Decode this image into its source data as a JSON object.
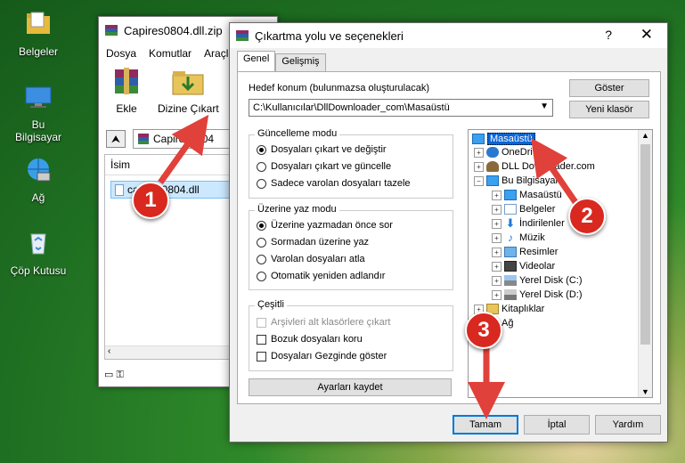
{
  "desktop": {
    "icons": [
      {
        "label": "Belgeler",
        "icon": "documents-folder-icon"
      },
      {
        "label": "Bu Bilgisayar",
        "icon": "computer-icon"
      },
      {
        "label": "Ağ",
        "icon": "network-icon"
      },
      {
        "label": "Çöp Kutusu",
        "icon": "recycle-bin-icon"
      }
    ]
  },
  "winrar": {
    "title": "Capires0804.dll.zip",
    "menu": [
      "Dosya",
      "Komutlar",
      "Araçla"
    ],
    "toolbar": {
      "add": "Ekle",
      "extract_to": "Dizine Çıkart"
    },
    "path": "Capires0804",
    "column_name": "İsim",
    "file": "capires0804.dll"
  },
  "dialog": {
    "title": "Çıkartma yolu ve seçenekleri",
    "help": "?",
    "close": "✕",
    "tabs": [
      "Genel",
      "Gelişmiş"
    ],
    "dest_label": "Hedef konum (bulunmazsa oluşturulacak)",
    "dest_value": "C:\\Kullanıcılar\\DllDownloader_com\\Masaüstü",
    "show_btn": "Göster",
    "new_folder_btn": "Yeni klasör",
    "update_mode": {
      "title": "Güncelleme modu",
      "options": [
        "Dosyaları çıkart ve değiştir",
        "Dosyaları çıkart ve güncelle",
        "Sadece varolan dosyaları tazele"
      ],
      "selected": 0
    },
    "overwrite_mode": {
      "title": "Üzerine yaz modu",
      "options": [
        "Üzerine yazmadan önce sor",
        "Sormadan üzerine yaz",
        "Varolan dosyaları atla",
        "Otomatik yeniden adlandır"
      ],
      "selected": 0
    },
    "misc": {
      "title": "Çeşitli",
      "options": [
        "Arşivleri alt klasörlere çıkart",
        "Bozuk dosyaları koru",
        "Dosyaları Gezginde göster"
      ]
    },
    "save_settings_btn": "Ayarları kaydet",
    "tree": [
      {
        "label": "Masaüstü",
        "level": 0,
        "icon": "desktop-icon",
        "exp": ""
      },
      {
        "label": "OneDrive",
        "level": 1,
        "icon": "onedrive-icon",
        "exp": "+"
      },
      {
        "label": "DLL Downloader.com",
        "level": 1,
        "icon": "user-icon",
        "exp": "+"
      },
      {
        "label": "Bu Bilgisayar",
        "level": 1,
        "icon": "computer-icon",
        "exp": "−"
      },
      {
        "label": "Masaüstü",
        "level": 2,
        "icon": "desktop-icon",
        "exp": "+"
      },
      {
        "label": "Belgeler",
        "level": 2,
        "icon": "documents-icon",
        "exp": "+"
      },
      {
        "label": "İndirilenler",
        "level": 2,
        "icon": "download-icon",
        "exp": "+"
      },
      {
        "label": "Müzik",
        "level": 2,
        "icon": "music-icon",
        "exp": "+"
      },
      {
        "label": "Resimler",
        "level": 2,
        "icon": "pictures-icon",
        "exp": "+"
      },
      {
        "label": "Videolar",
        "level": 2,
        "icon": "videos-icon",
        "exp": "+"
      },
      {
        "label": "Yerel Disk (C:)",
        "level": 2,
        "icon": "disk-icon",
        "exp": "+"
      },
      {
        "label": "Yerel Disk (D:)",
        "level": 2,
        "icon": "disk-icon",
        "exp": "+"
      },
      {
        "label": "Kitaplıklar",
        "level": 1,
        "icon": "library-icon",
        "exp": "+"
      },
      {
        "label": "Ağ",
        "level": 1,
        "icon": "network-icon",
        "exp": "+"
      }
    ],
    "ok_btn": "Tamam",
    "cancel_btn": "İptal",
    "help_btn": "Yardım"
  },
  "annotations": {
    "step1": "1",
    "step2": "2",
    "step3": "3",
    "arrow_color": "#e0413a"
  }
}
